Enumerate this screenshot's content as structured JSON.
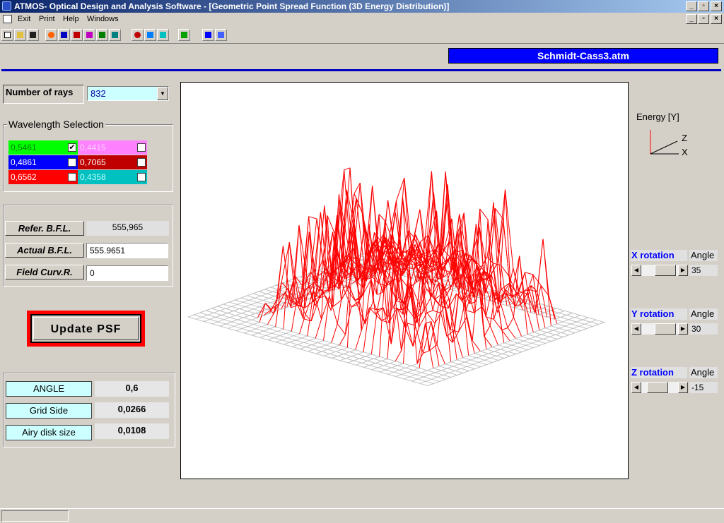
{
  "window": {
    "title": "ATMOS- Optical Design and Analysis Software - [Geometric Point Spread Function (3D Energy Distribution)]"
  },
  "menu": {
    "items": [
      "Exit",
      "Print",
      "Help",
      "Windows"
    ]
  },
  "file": {
    "name": "Schmidt-Cass3.atm"
  },
  "rays": {
    "label": "Number of rays",
    "value": "832"
  },
  "wavelength": {
    "title": "Wavelength Selection",
    "items": [
      {
        "value": "0,5461",
        "color": "#00ff00",
        "checked": "✔"
      },
      {
        "value": "0,4415",
        "color": "#ff80ff",
        "checked": ""
      },
      {
        "value": "0,4861",
        "color": "#0000ff",
        "checked": ""
      },
      {
        "value": "0,7065",
        "color": "#c00000",
        "checked": ""
      },
      {
        "value": "0,6562",
        "color": "#ff0000",
        "checked": ""
      },
      {
        "value": "0,4358",
        "color": "#00c0c0",
        "checked": ""
      }
    ]
  },
  "bfl": {
    "refer_label": "Refer.  B.F.L.",
    "refer_value": "555,965",
    "actual_label": "Actual B.F.L.",
    "actual_value": "555.9651",
    "field_label": "Field Curv.R.",
    "field_value": "0"
  },
  "update_button": "Update PSF",
  "info": {
    "angle_label": "ANGLE",
    "angle_value": "0,6",
    "grid_label": "Grid  Side",
    "grid_value": "0,0266",
    "airy_label": "Airy disk size",
    "airy_value": "0,0108"
  },
  "axes": {
    "energy_label": "Energy [Y]",
    "z": "Z",
    "x": "X"
  },
  "rotation": {
    "x": {
      "label": "X rotation",
      "angle_label": "Angle",
      "value": "35"
    },
    "y": {
      "label": "Y rotation",
      "angle_label": "Angle",
      "value": "30"
    },
    "z": {
      "label": "Z rotation",
      "angle_label": "Angle",
      "value": "-15"
    }
  },
  "colors": {
    "plot_line": "#ff0000",
    "grid": "#c0c0c0",
    "accent": "#0000ff"
  }
}
